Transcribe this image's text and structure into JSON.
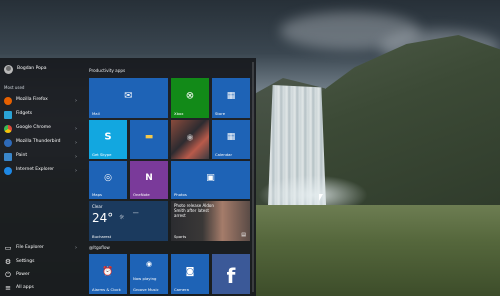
{
  "start_menu": {
    "user_name": "Bogdan Popa",
    "most_used_label": "Most used",
    "apps": [
      {
        "label": "Mozilla Firefox",
        "icon": "firefox-icon",
        "color": "#e66000",
        "has_submenu": true
      },
      {
        "label": "Fidgets",
        "icon": "fidgets-icon",
        "color": "#2aa3d6",
        "has_submenu": false
      },
      {
        "label": "Google Chrome",
        "icon": "chrome-icon",
        "color": "#dd4b39",
        "has_submenu": true
      },
      {
        "label": "Mozilla Thunderbird",
        "icon": "thunderbird-icon",
        "color": "#2e6ab8",
        "has_submenu": true
      },
      {
        "label": "Paint",
        "icon": "paint-icon",
        "color": "#3a86c9",
        "has_submenu": true
      },
      {
        "label": "Internet Explorer",
        "icon": "ie-icon",
        "color": "#1e88e5",
        "has_submenu": true
      }
    ],
    "bottom": [
      {
        "label": "File Explorer",
        "icon": "folder-icon",
        "has_submenu": true
      },
      {
        "label": "Settings",
        "icon": "gear-icon",
        "has_submenu": false
      },
      {
        "label": "Power",
        "icon": "power-icon",
        "has_submenu": false
      },
      {
        "label": "All apps",
        "icon": "list-icon",
        "has_submenu": false
      }
    ],
    "group1_title": "Productivity apps",
    "group2_title": "@ltgoflow",
    "tiles": {
      "mail": "Mail",
      "xbox": "Xbox",
      "store": "Store",
      "skype": "Get Skype",
      "explorer": "",
      "people": "",
      "calendar": "Calendar",
      "maps": "Maps",
      "onenote": "OneNote",
      "photos": "Photos",
      "weather_condition": "Clear",
      "weather_temp": "24°",
      "weather_city": "Bucharest",
      "news_text": "Photo release Aldon Smith after latest arrest",
      "news_source": "Sports",
      "alarms": "Alarms & Clock",
      "groove": "Groove Music",
      "groove_now_playing": "Now playing",
      "camera": "Camera",
      "facebook": ""
    }
  },
  "colors": {
    "tile_blue": "#1e63b6",
    "xbox_green": "#128a18",
    "onenote_purple": "#7a3a9a",
    "skype_blue": "#12a7e0"
  }
}
